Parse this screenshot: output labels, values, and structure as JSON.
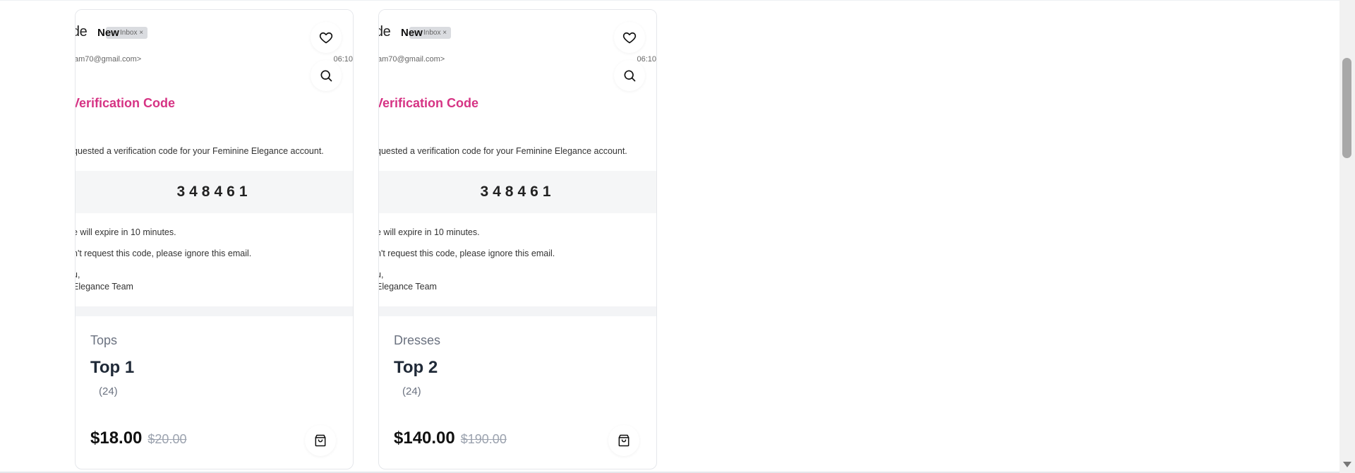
{
  "products": [
    {
      "category": "Tops",
      "name": "Top 1",
      "reviews": "(24)",
      "price": "$18.00",
      "old_price": "$20.00",
      "image": {
        "subject": "ode",
        "badge": "New",
        "inbox_tag": "Inbox ×",
        "sender": "am70@gmail.com>",
        "time": "06:10",
        "heading": "Verification Code",
        "intro": "quested a verification code for your Feminine Elegance account.",
        "code": "348461",
        "expiry": "e will expire in 10 minutes.",
        "ignore": "n't request this code, please ignore this email.",
        "signoff": "u,",
        "team": "Elegance Team"
      }
    },
    {
      "category": "Dresses",
      "name": "Top 2",
      "reviews": "(24)",
      "price": "$140.00",
      "old_price": "$190.00",
      "image": {
        "subject": "ode",
        "badge": "New",
        "inbox_tag": "Inbox ×",
        "sender": "am70@gmail.com>",
        "time": "06:10",
        "heading": "Verification Code",
        "intro": "quested a verification code for your Feminine Elegance account.",
        "code": "348461",
        "expiry": "e will expire in 10 minutes.",
        "ignore": "n't request this code, please ignore this email.",
        "signoff": "u,",
        "team": "Elegance Team"
      }
    }
  ],
  "icons": {
    "favorite": "heart-icon",
    "zoom": "search-icon",
    "cart": "shopping-bag-icon"
  },
  "colors": {
    "heading_accent": "#d63384",
    "category_text": "#6b7280",
    "old_price": "#9ca3af"
  }
}
